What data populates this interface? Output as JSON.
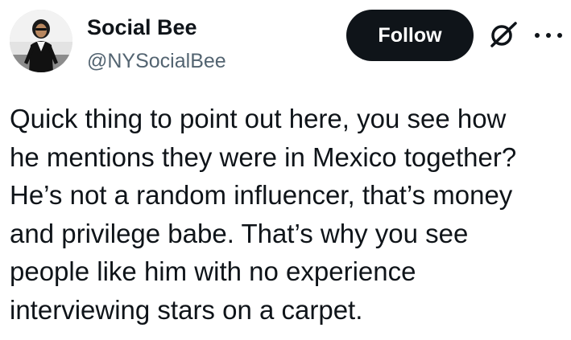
{
  "author": {
    "display_name": "Social Bee",
    "handle": "@NYSocialBee"
  },
  "actions": {
    "follow_label": "Follow",
    "grok_icon": "grok-slash-icon",
    "more_icon": "more-horizontal-icon"
  },
  "tweet": {
    "text": "Quick thing to point out here, you see how\nhe mentions they were in Mexico together?\nHe’s not a random influencer, that’s money\nand privilege babe. That’s why you see\npeople like him with no experience\ninterviewing stars on a carpet."
  },
  "colors": {
    "text": "#0f1419",
    "secondary": "#536471",
    "button_bg": "#0f1419",
    "button_text": "#ffffff",
    "background": "#ffffff"
  }
}
